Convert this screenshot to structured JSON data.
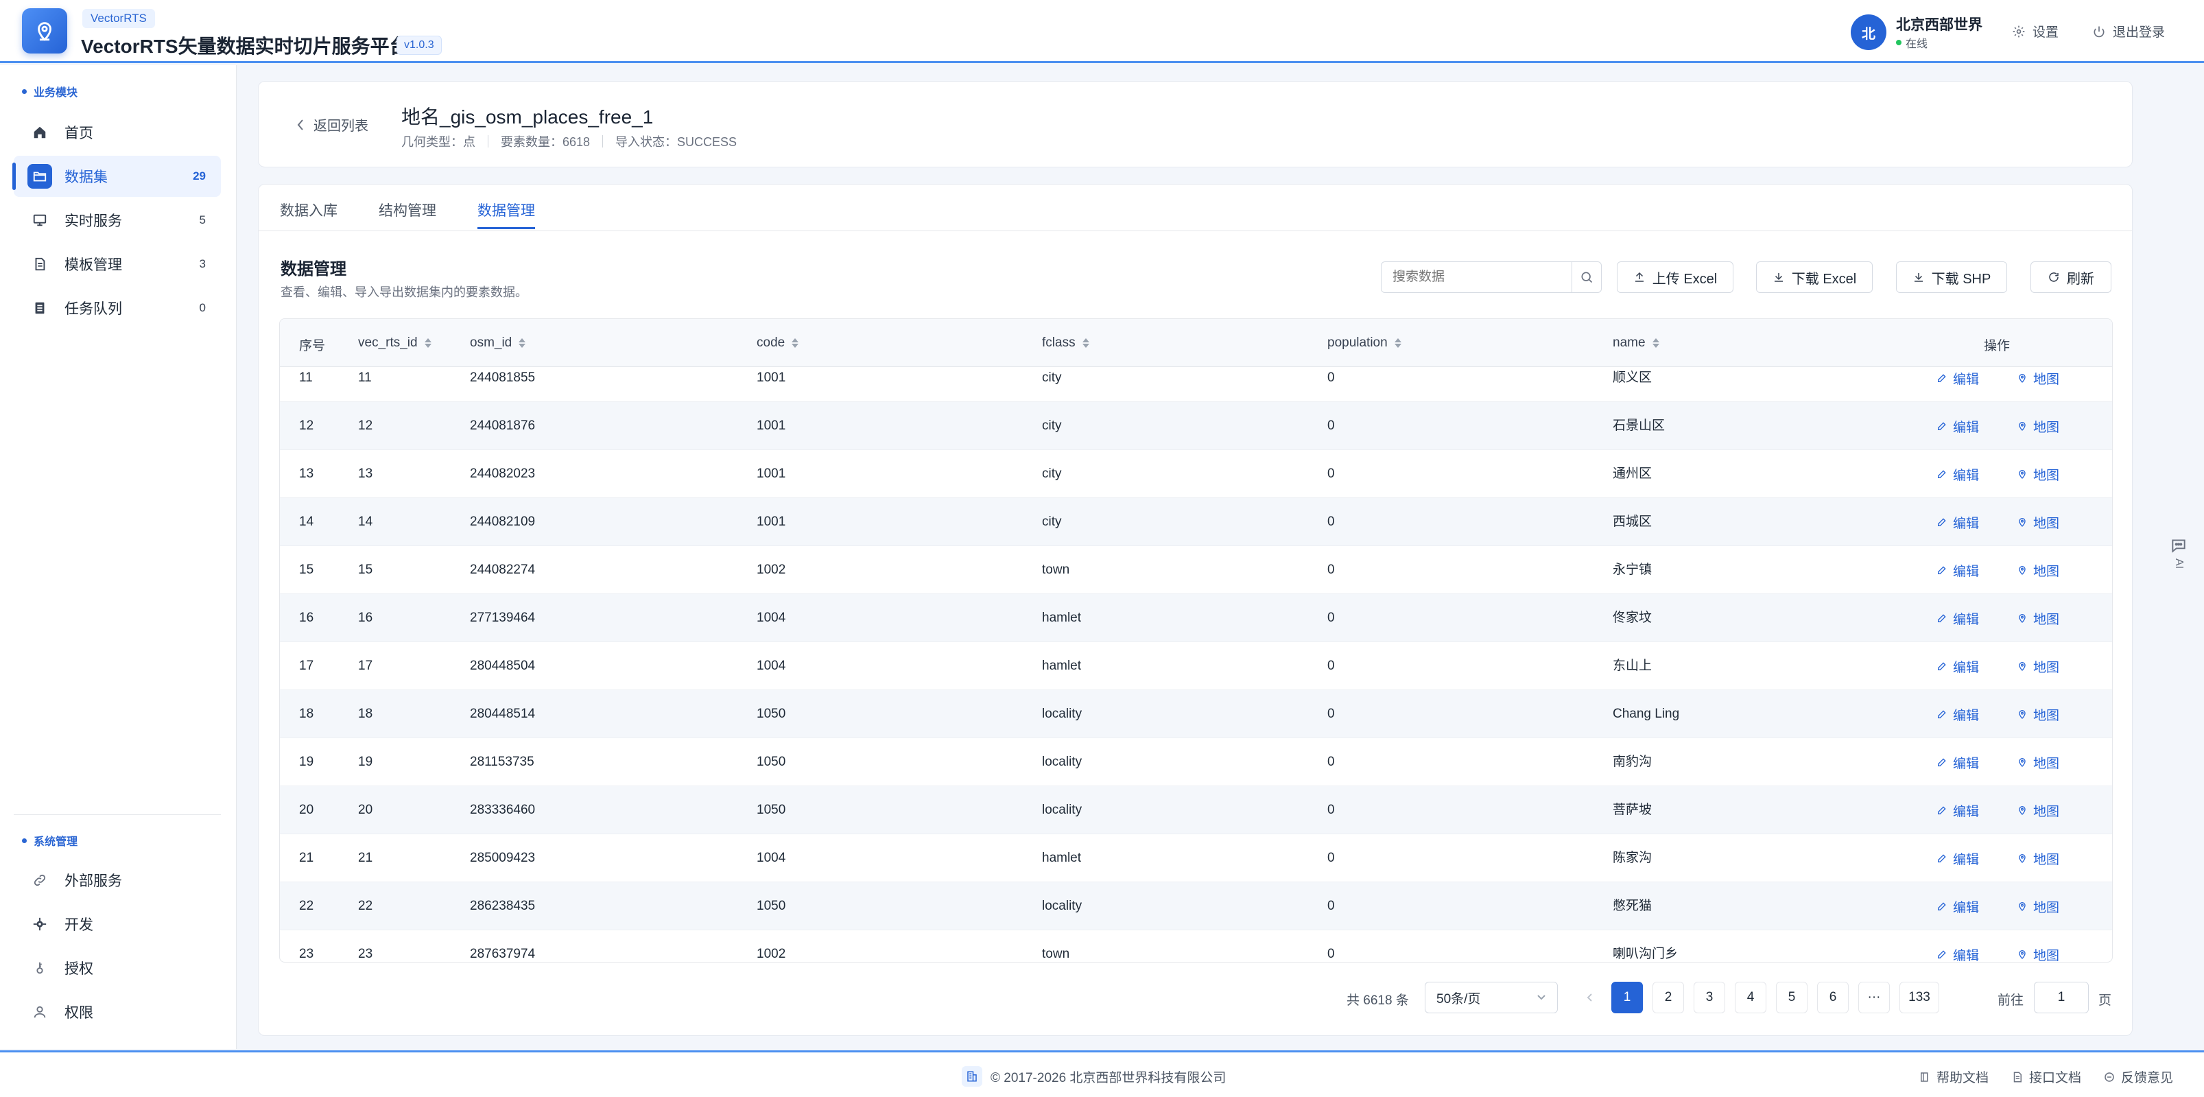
{
  "app": {
    "brand_tag": "VectorRTS",
    "title": "VectorRTS矢量数据实时切片服务平台",
    "version": "v1.0.3",
    "accent_color": "#2563d6"
  },
  "header": {
    "avatar_text": "北",
    "user_name": "北京西部世界",
    "user_status": "在线",
    "settings_label": "设置",
    "logout_label": "退出登录"
  },
  "sidebar": {
    "section_business": "业务模块",
    "section_system": "系统管理",
    "business_items": [
      {
        "label": "首页",
        "icon": "home-icon",
        "count": ""
      },
      {
        "label": "数据集",
        "icon": "folder-icon",
        "count": "29"
      },
      {
        "label": "实时服务",
        "icon": "monitor-icon",
        "count": "5"
      },
      {
        "label": "模板管理",
        "icon": "document-icon",
        "count": "3"
      },
      {
        "label": "任务队列",
        "icon": "queue-icon",
        "count": "0"
      }
    ],
    "system_items": [
      {
        "label": "外部服务",
        "icon": "link-icon"
      },
      {
        "label": "开发",
        "icon": "gear-icon"
      },
      {
        "label": "授权",
        "icon": "key-icon"
      },
      {
        "label": "权限",
        "icon": "user-icon"
      }
    ]
  },
  "dataset": {
    "back_label": "返回列表",
    "name": "地名_gis_osm_places_free_1",
    "geometry": "几何类型：点",
    "feature_count": "要素数量：6618",
    "import_status": "导入状态：SUCCESS"
  },
  "tabs": [
    "数据入库",
    "结构管理",
    "数据管理"
  ],
  "active_tab": "数据管理",
  "section": {
    "title": "数据管理",
    "description": "查看、编辑、导入导出数据集内的要素数据。"
  },
  "toolbar": {
    "search_placeholder": "搜索数据",
    "upload_excel": "上传 Excel",
    "download_excel": "下载 Excel",
    "download_shp": "下载 SHP",
    "refresh": "刷新"
  },
  "table": {
    "columns": [
      "序号",
      "vec_rts_id",
      "osm_id",
      "code",
      "fclass",
      "population",
      "name",
      "操作"
    ],
    "edit_label": "编辑",
    "map_label": "地图",
    "rows": [
      [
        "11",
        "11",
        "244081855",
        "1001",
        "city",
        "0",
        "顺义区"
      ],
      [
        "12",
        "12",
        "244081876",
        "1001",
        "city",
        "0",
        "石景山区"
      ],
      [
        "13",
        "13",
        "244082023",
        "1001",
        "city",
        "0",
        "通州区"
      ],
      [
        "14",
        "14",
        "244082109",
        "1001",
        "city",
        "0",
        "西城区"
      ],
      [
        "15",
        "15",
        "244082274",
        "1002",
        "town",
        "0",
        "永宁镇"
      ],
      [
        "16",
        "16",
        "277139464",
        "1004",
        "hamlet",
        "0",
        "佟家坟"
      ],
      [
        "17",
        "17",
        "280448504",
        "1004",
        "hamlet",
        "0",
        "东山上"
      ],
      [
        "18",
        "18",
        "280448514",
        "1050",
        "locality",
        "0",
        "Chang Ling"
      ],
      [
        "19",
        "19",
        "281153735",
        "1050",
        "locality",
        "0",
        "南豹沟"
      ],
      [
        "20",
        "20",
        "283336460",
        "1050",
        "locality",
        "0",
        "菩萨坡"
      ],
      [
        "21",
        "21",
        "285009423",
        "1004",
        "hamlet",
        "0",
        "陈家沟"
      ],
      [
        "22",
        "22",
        "286238435",
        "1050",
        "locality",
        "0",
        "憋死猫"
      ],
      [
        "23",
        "23",
        "287637974",
        "1002",
        "town",
        "0",
        "喇叭沟门乡"
      ]
    ]
  },
  "pagination": {
    "total": "共 6618 条",
    "page_size": "50条/页",
    "pages": [
      "1",
      "2",
      "3",
      "4",
      "5",
      "6",
      "···",
      "133"
    ],
    "current": "1",
    "goto_label": "前往",
    "goto_value": "1",
    "page_suffix": "页"
  },
  "footer": {
    "copyright": "© 2017-2026 北京西部世界科技有限公司",
    "help_docs": "帮助文档",
    "api_docs": "接口文档",
    "feedback": "反馈意见"
  },
  "ai_button": "AI"
}
